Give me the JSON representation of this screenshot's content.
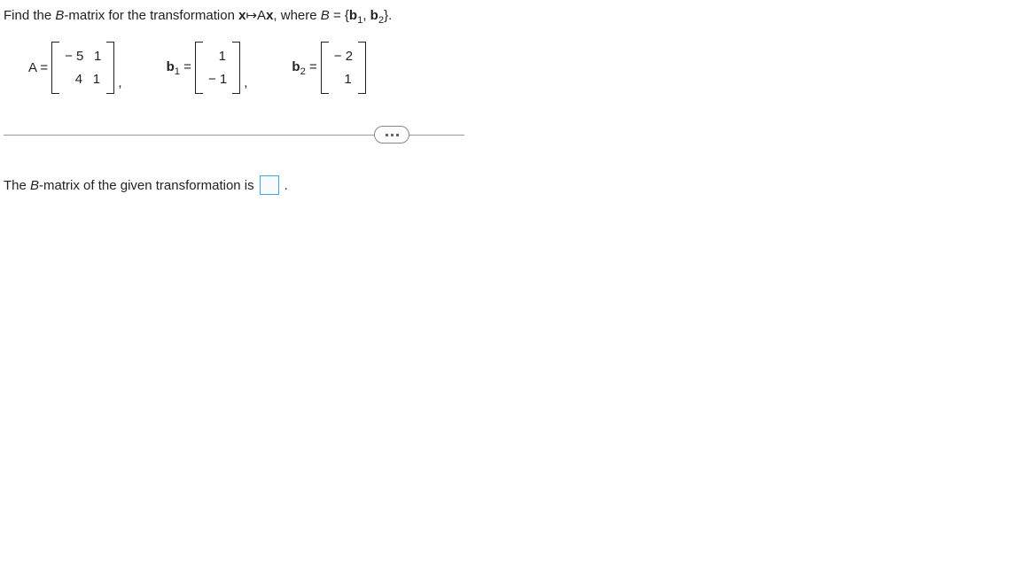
{
  "question": {
    "prefix": "Find the ",
    "bmatrix_text": "B",
    "text1": "-matrix for the transformation ",
    "x_text": "x",
    "mapsto": "↦",
    "ax_a": "A",
    "ax_x": "x",
    "text2": ", where ",
    "b_italic": "B",
    "equals": " = {",
    "b1_b": "b",
    "b1_sub": "1",
    "sep": ", ",
    "b2_b": "b",
    "b2_sub": "2",
    "close": "}."
  },
  "matrices": {
    "A_label": "A =",
    "A": {
      "r1c1": "− 5",
      "r1c2": "1",
      "r2c1": "4",
      "r2c2": "1"
    },
    "b1_label_b": "b",
    "b1_label_sub": "1",
    "b1_label_eq": " =",
    "b1": {
      "r1": "1",
      "r2": "− 1"
    },
    "b2_label_b": "b",
    "b2_label_sub": "2",
    "b2_label_eq": " =",
    "b2": {
      "r1": "− 2",
      "r2": "1"
    },
    "comma": ","
  },
  "answer": {
    "prefix": "The ",
    "b_italic": "B",
    "text": "-matrix of the given transformation is ",
    "period": "."
  }
}
